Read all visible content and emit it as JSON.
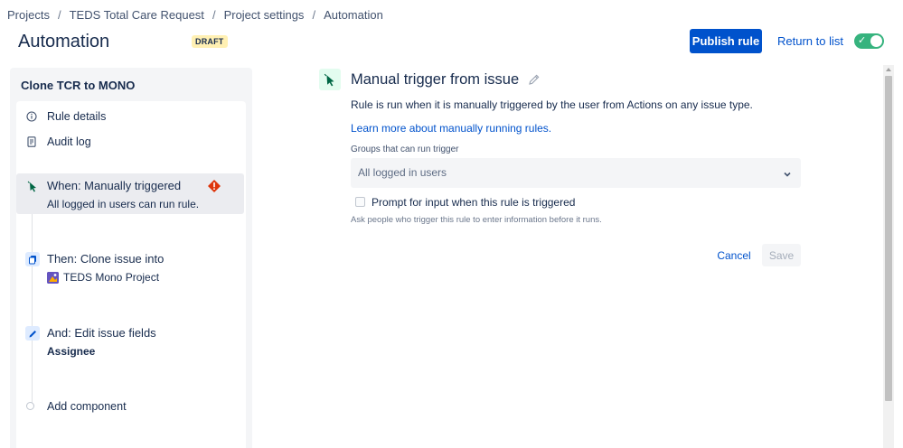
{
  "breadcrumb": [
    "Projects",
    "TEDS Total Care Request",
    "Project settings",
    "Automation"
  ],
  "breadcrumb_separator": "/",
  "header": {
    "title": "Automation",
    "status_badge": "DRAFT",
    "publish_label": "Publish rule",
    "return_label": "Return to list",
    "enabled": true
  },
  "sidebar": {
    "rule_name": "Clone TCR to MONO",
    "menu": [
      {
        "label": "Rule details",
        "icon": "info-icon"
      },
      {
        "label": "Audit log",
        "icon": "document-icon"
      }
    ],
    "steps": [
      {
        "title": "When: Manually triggered",
        "subtitle": "All logged in users can run rule.",
        "icon": "cursor-icon",
        "has_warning": true
      },
      {
        "title": "Then: Clone issue into",
        "subtitle": "TEDS Mono Project",
        "icon": "copy-icon"
      },
      {
        "title": "And: Edit issue fields",
        "subtitle": "Assignee",
        "icon": "pencil-icon"
      }
    ],
    "add_component_label": "Add component"
  },
  "panel": {
    "title": "Manual trigger from issue",
    "description": "Rule is run when it is manually triggered by the user from Actions on any issue type.",
    "learn_more": "Learn more about manually running rules.",
    "groups_label": "Groups that can run trigger",
    "groups_value": "All logged in users",
    "prompt_label": "Prompt for input when this rule is triggered",
    "prompt_checked": false,
    "prompt_helper": "Ask people who trigger this rule to enter information before it runs.",
    "cancel_label": "Cancel",
    "save_label": "Save"
  },
  "colors": {
    "primary": "#0052cc",
    "toggle_on": "#36b37e",
    "warning": "#de350b",
    "trigger_bg": "#e3fcef",
    "action_bg": "#deebff",
    "badge_bg": "#fff0b3"
  }
}
